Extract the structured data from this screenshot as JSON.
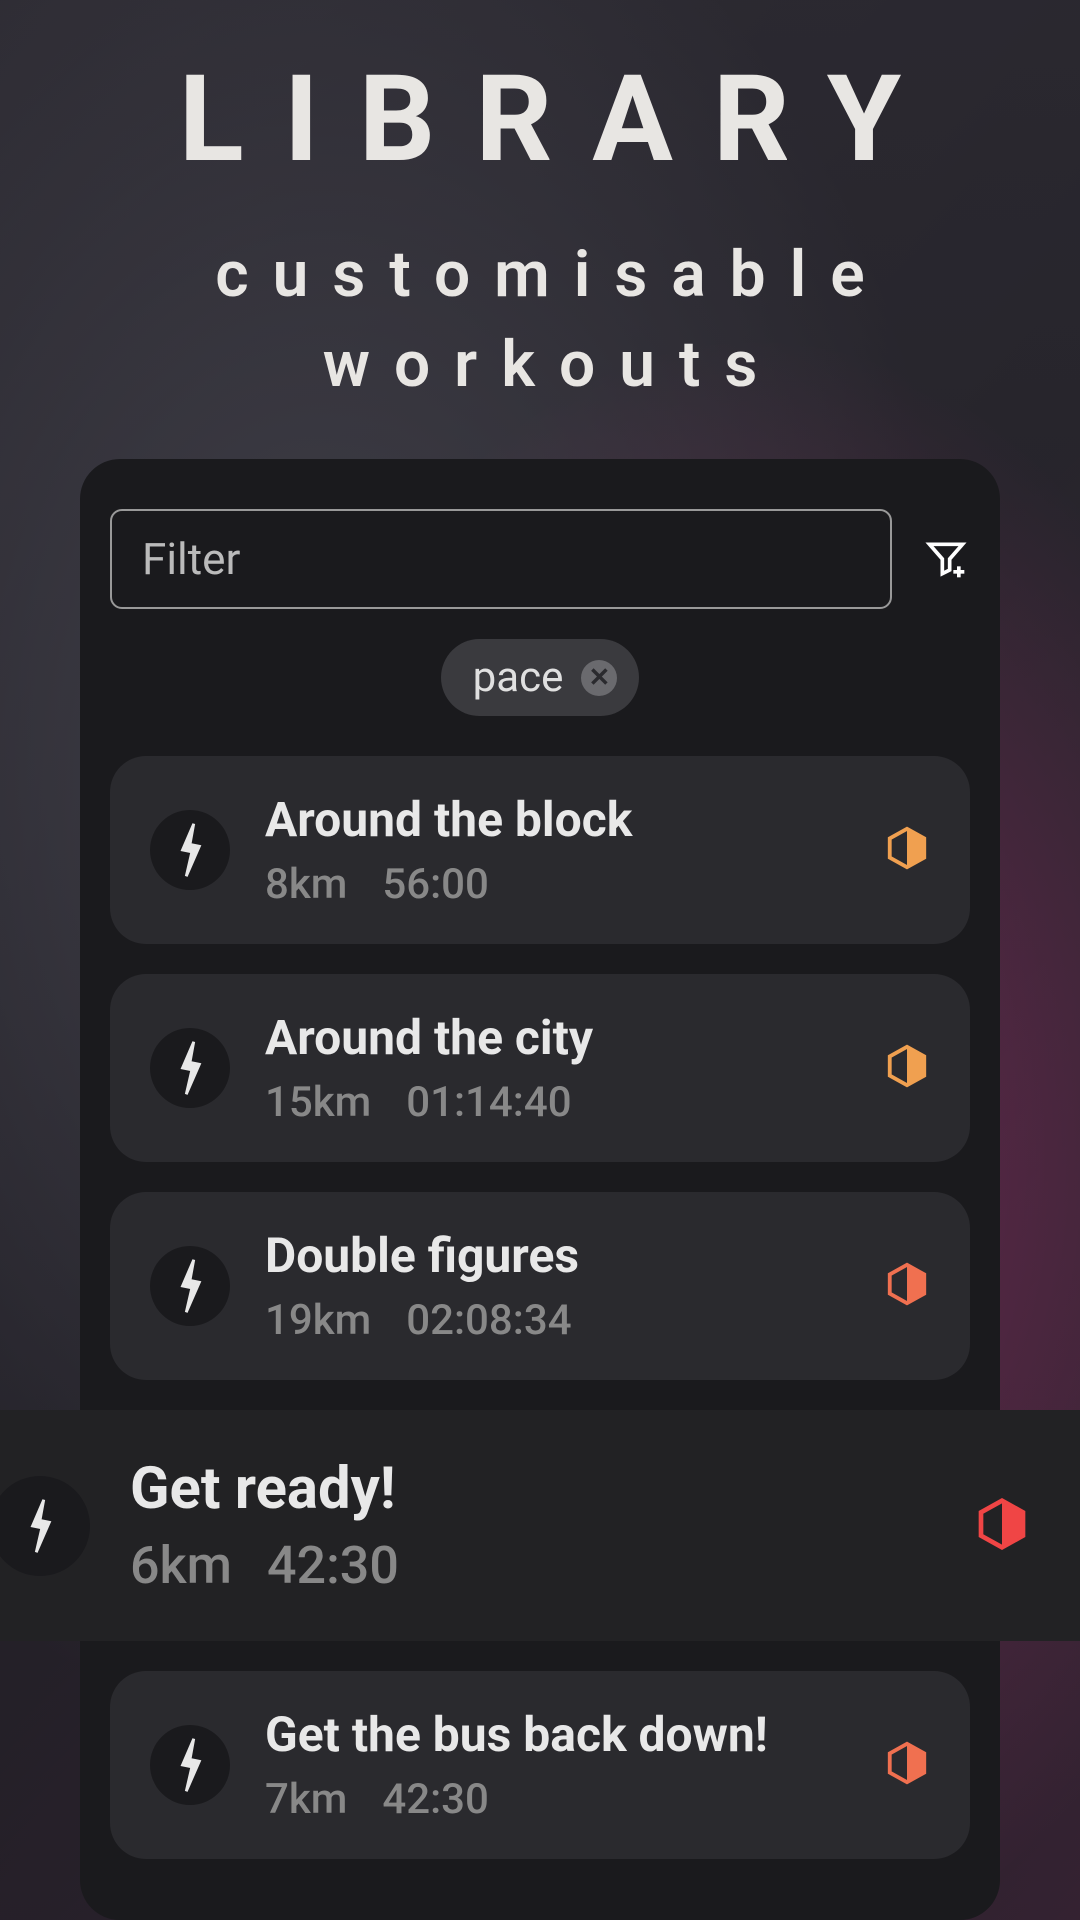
{
  "header": {
    "title": "LIBRARY",
    "subtitle_line1": "customisable",
    "subtitle_line2": "workouts"
  },
  "filter": {
    "placeholder": "Filter"
  },
  "chip": {
    "label": "pace"
  },
  "workouts": [
    {
      "title": "Around the block",
      "distance": "8km",
      "duration": "56:00",
      "difficulty_color": "#f0a050"
    },
    {
      "title": "Around the city",
      "distance": "15km",
      "duration": "01:14:40",
      "difficulty_color": "#f0a050"
    },
    {
      "title": "Double figures",
      "distance": "19km",
      "duration": "02:08:34",
      "difficulty_color": "#f07050"
    },
    {
      "title": "Get ready!",
      "distance": "6km",
      "duration": "42:30",
      "difficulty_color": "#f04545",
      "highlighted": true
    },
    {
      "title": "Get the bus back down!",
      "distance": "7km",
      "duration": "42:30",
      "difficulty_color": "#f07050"
    }
  ]
}
